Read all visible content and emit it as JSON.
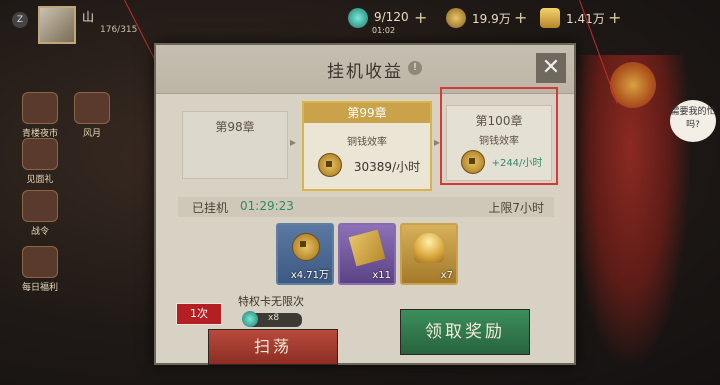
{
  "topbar": {
    "avatar_letter": "Z",
    "player_name": "山",
    "player_stats": "176/315",
    "resources": [
      {
        "icon": "energy-gem-icon",
        "value": "9/120",
        "sub": "01:02"
      },
      {
        "icon": "coin-icon",
        "value": "19.9万"
      },
      {
        "icon": "gold-ingot-icon",
        "value": "1.41万"
      }
    ]
  },
  "side_menu": [
    {
      "label": "青楼夜市"
    },
    {
      "label": "风月"
    },
    {
      "label": "见面礼"
    },
    {
      "label": "战令"
    },
    {
      "label": "每日福利"
    }
  ],
  "speech_bubble": "需要我的忙吗?",
  "panel": {
    "title": "挂机收益",
    "info_icon_char": "!",
    "close_char": "✕",
    "chapters": [
      {
        "title": "第98章",
        "rate_label": "",
        "rate_value": ""
      },
      {
        "title": "第99章",
        "rate_label": "铜钱效率",
        "rate_value": "30389/小时"
      },
      {
        "title": "第100章",
        "rate_label": "铜钱效率",
        "rate_value": "+244/小时"
      }
    ],
    "idle": {
      "label": "已挂机",
      "time": "01:29:23",
      "limit": "上限7小时"
    },
    "rewards": [
      {
        "icon": "copper-coin-icon",
        "count": "x4.71万"
      },
      {
        "icon": "scroll-icon",
        "count": "x11"
      },
      {
        "icon": "gold-ingot-icon",
        "count": "x7"
      }
    ],
    "premium_label": "特权卡无限次",
    "times_badge": "1次",
    "gem_count": "x8",
    "sweep_button": "扫荡",
    "claim_button": "领取奖励"
  },
  "colors": {
    "highlight_red": "#d43a3a",
    "selected_gold": "#d9b44a",
    "idle_time": "#2d8a6a",
    "sweep_red": "#a53b2f",
    "claim_green": "#3a8656"
  }
}
